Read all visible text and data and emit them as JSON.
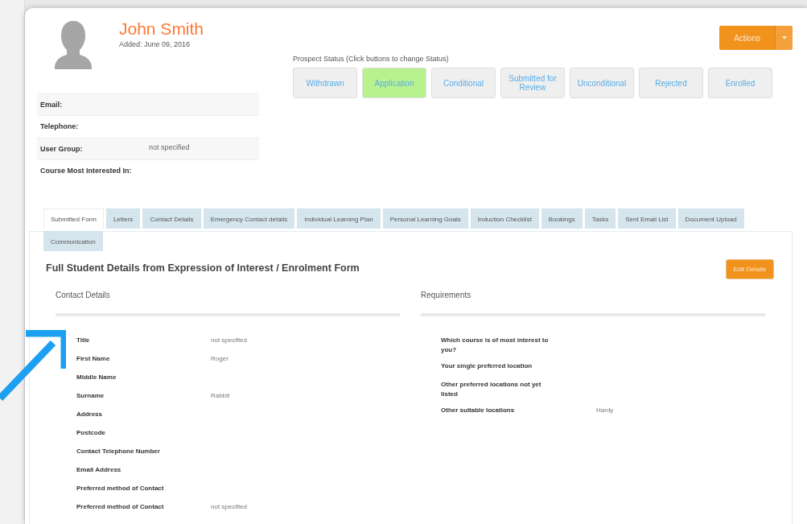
{
  "profile": {
    "name": "John Smith",
    "added": "Added: June 09, 2016"
  },
  "info_rows": [
    {
      "label": "Email:",
      "value": ""
    },
    {
      "label": "Telephone:",
      "value": ""
    },
    {
      "label": "User Group:",
      "value": "not specified"
    },
    {
      "label": "Course Most Interested In:",
      "value": ""
    }
  ],
  "prospect_status": {
    "label": "Prospect Status (Click buttons to change Status)",
    "buttons": [
      {
        "label": "Withdrawn",
        "selected": false
      },
      {
        "label": "Application",
        "selected": true
      },
      {
        "label": "Conditional",
        "selected": false
      },
      {
        "label": "Submitted for Review",
        "selected": false
      },
      {
        "label": "Unconditional",
        "selected": false
      },
      {
        "label": "Rejected",
        "selected": false
      },
      {
        "label": "Enrolled",
        "selected": false
      }
    ]
  },
  "actions_button": "Actions",
  "tabs": [
    {
      "label": "Submitted Form",
      "selected": true
    },
    {
      "label": "Letters",
      "selected": false
    },
    {
      "label": "Contact Details",
      "selected": false
    },
    {
      "label": "Emergency Contact details",
      "selected": false
    },
    {
      "label": "Individual Learning Plan",
      "selected": false
    },
    {
      "label": "Personal Learning Goals",
      "selected": false
    },
    {
      "label": "Induction Checklist",
      "selected": false
    },
    {
      "label": "Bookings",
      "selected": false
    },
    {
      "label": "Tasks",
      "selected": false
    },
    {
      "label": "Sent Email List",
      "selected": false
    },
    {
      "label": "Document Upload",
      "selected": false
    },
    {
      "label": "Communication",
      "selected": false
    }
  ],
  "form": {
    "title": "Full Student Details from Expression of Interest / Enrolment Form",
    "edit_button": "Edit Details",
    "sections": [
      {
        "title": "Contact Details",
        "rows": [
          {
            "label": "Title",
            "value": "not specified"
          },
          {
            "label": "First Name",
            "value": "Roger"
          },
          {
            "label": "Middle Name",
            "value": ""
          },
          {
            "label": "Surname",
            "value": "Rabbit"
          },
          {
            "label": "Address",
            "value": ""
          },
          {
            "label": "Postcode",
            "value": ""
          },
          {
            "label": "Contact Telephone Number",
            "value": ""
          },
          {
            "label": "Email Address",
            "value": ""
          },
          {
            "label": "Preferred method of Contact",
            "value": ""
          },
          {
            "label": "Preferred method of Contact",
            "value": "not specified"
          }
        ]
      },
      {
        "title": "Requirements",
        "rows": [
          {
            "label": "Which course is of most interest to you?",
            "value": ""
          },
          {
            "label": "Your single preferred location",
            "value": ""
          },
          {
            "label": "Other preferred locations not yet listed",
            "value": ""
          },
          {
            "label": "Other suitable locations",
            "value": "Hardy"
          }
        ]
      }
    ]
  }
}
